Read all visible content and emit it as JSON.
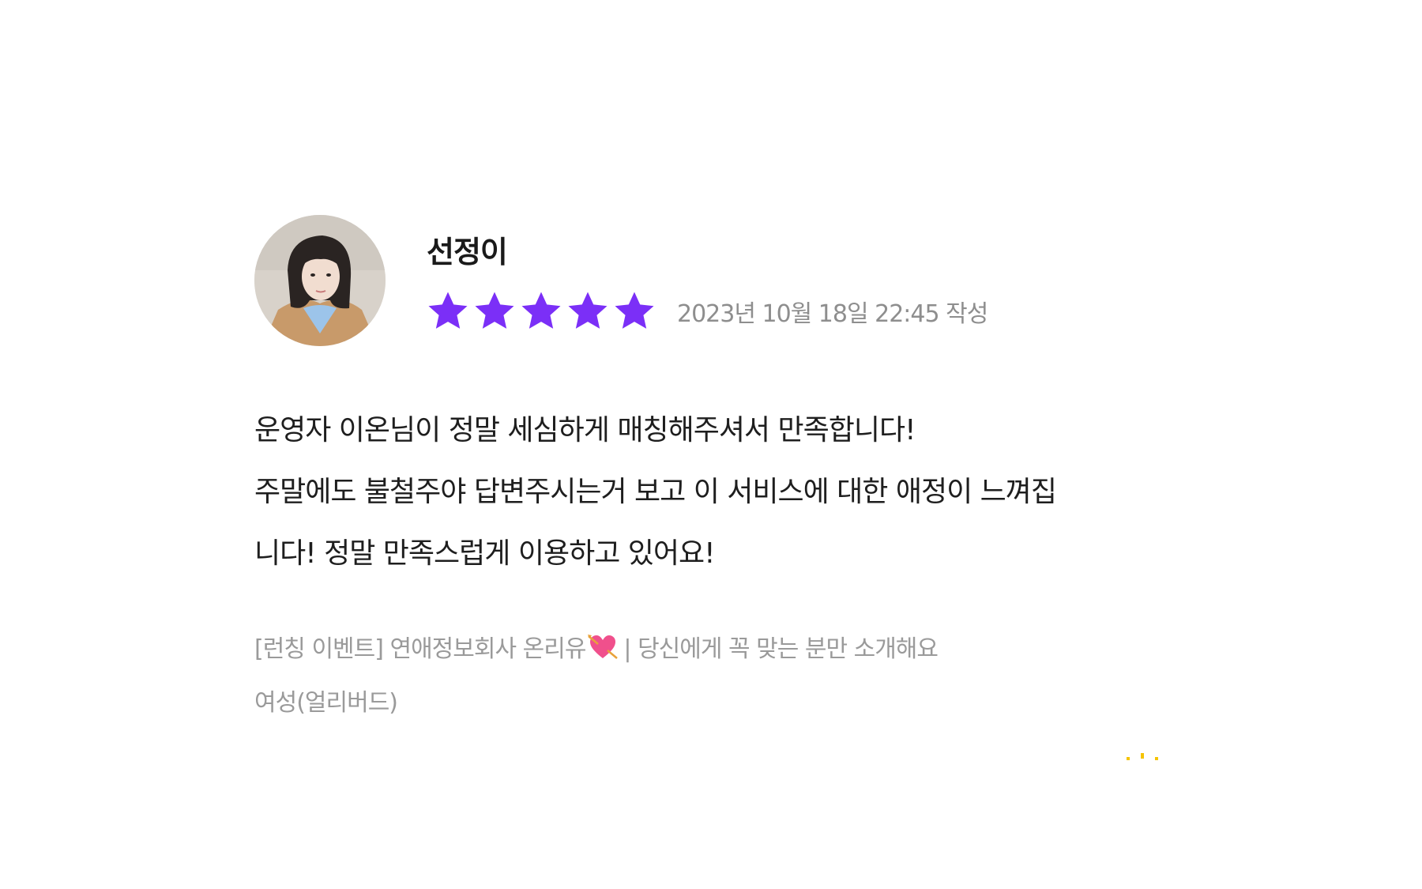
{
  "review": {
    "reviewer_name": "선정이",
    "rating": 5,
    "rating_max": 5,
    "date": "2023년 10월 18일 22:45 작성",
    "body_lines": [
      "운영자 이온님이 정말 세심하게 매칭해주셔서 만족합니다!",
      "주말에도 불철주야 답변주시는거 보고 이 서비스에 대한 애정이 느껴집",
      "니다! 정말 만족스럽게 이용하고 있어요!"
    ]
  },
  "product": {
    "title_before_icon": "[런칭 이벤트] 연애정보회사 온리유",
    "icon": "heart-with-arrow-icon",
    "title_after_icon": "| 당신에게 꼭 맞는 분만 소개해요",
    "option": "여성(얼리버드)"
  },
  "colors": {
    "star": "#7b2ff7",
    "text_primary": "#1e1e1e",
    "text_secondary": "#8e8e8e",
    "sparkle": "#f5c400"
  }
}
